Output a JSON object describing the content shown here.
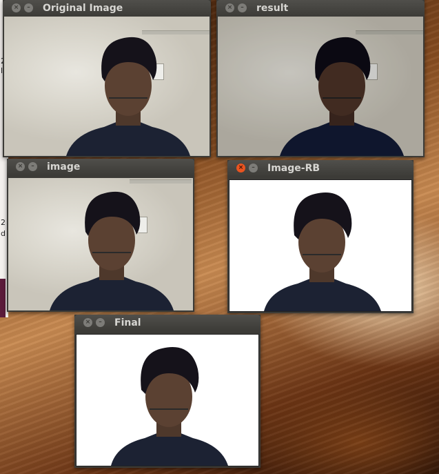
{
  "windows": {
    "original": {
      "title": "Original Image"
    },
    "result": {
      "title": "result"
    },
    "image": {
      "title": "image"
    },
    "image_rb": {
      "title": "Image-RB"
    },
    "final": {
      "title": "Final"
    }
  },
  "buttons": {
    "close_glyph": "×",
    "minimize_glyph": "–"
  },
  "left_strip": {
    "mark_1": "2",
    "mark_2": "l",
    "mark_3": "2",
    "mark_4": "d"
  },
  "colors": {
    "titlebar": "#3c3b37",
    "title_text": "#d7d6d2",
    "close_active": "#e95420",
    "button_inactive": "#7d7c78",
    "shirt": "#1c2233",
    "hair": "#15121a",
    "skin": "#5b4132"
  }
}
